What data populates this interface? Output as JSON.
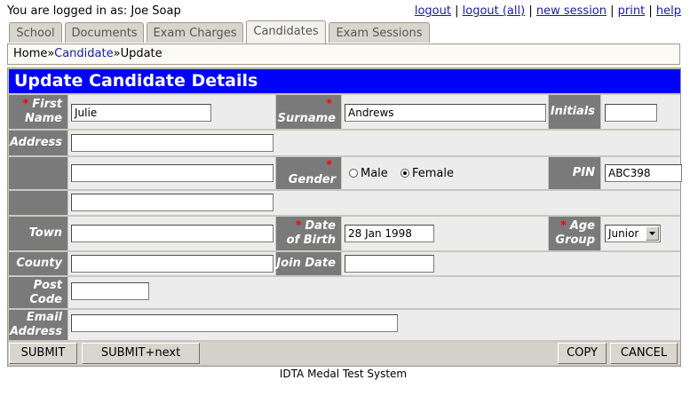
{
  "header": {
    "logged_in_text": "You are logged in as: Joe Soap",
    "links": [
      "logout",
      "logout (all)",
      "new session",
      "print",
      "help"
    ]
  },
  "tabs": [
    {
      "label": "School",
      "active": false
    },
    {
      "label": "Documents",
      "active": false
    },
    {
      "label": "Exam Charges",
      "active": false
    },
    {
      "label": "Candidates",
      "active": true
    },
    {
      "label": "Exam Sessions",
      "active": false
    }
  ],
  "breadcrumb": {
    "home": "Home",
    "sep": "»",
    "section": "Candidate",
    "page": "Update"
  },
  "form": {
    "title": "Update Candidate Details",
    "required_mark": "*",
    "labels": {
      "first_name_1": "First",
      "first_name_2": "Name",
      "surname": "Surname",
      "initials": "Initials",
      "address": "Address",
      "gender": "Gender",
      "pin": "PIN",
      "town": "Town",
      "dob_1": "Date",
      "dob_2": "of Birth",
      "age_1": "Age",
      "age_2": "Group",
      "county": "County",
      "join_date": "Join Date",
      "post_1": "Post",
      "post_2": "Code",
      "email_1": "Email",
      "email_2": "Address"
    },
    "values": {
      "first_name": "Julie",
      "surname": "Andrews",
      "initials": "",
      "address1": "",
      "address2": "",
      "address3": "",
      "pin": "ABC398",
      "town": "",
      "dob": "28 Jan 1998",
      "age_group": "Junior",
      "county": "",
      "join_date": "",
      "post_code": "",
      "email": ""
    },
    "gender": {
      "male": "Male",
      "female": "Female",
      "selected": "Female"
    }
  },
  "buttons": {
    "submit": "SUBMIT",
    "submit_next": "SUBMIT+next",
    "copy": "COPY",
    "cancel": "CANCEL"
  },
  "footer": "IDTA Medal Test System"
}
